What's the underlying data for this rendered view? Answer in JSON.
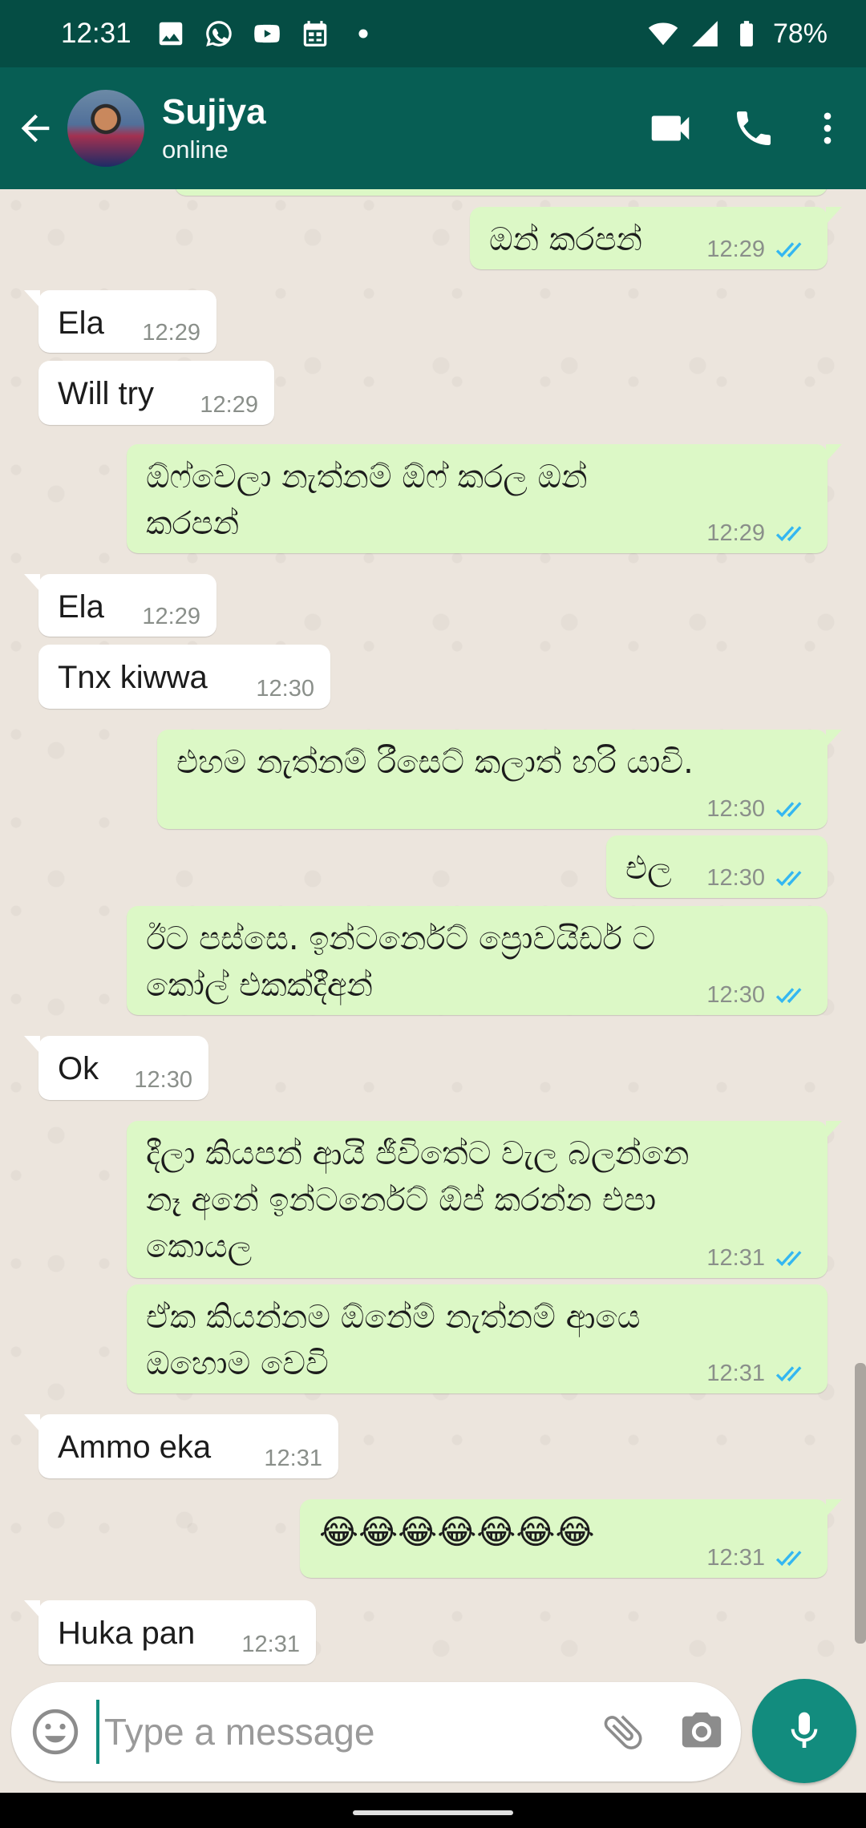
{
  "status_bar": {
    "time": "12:31",
    "battery": "78%",
    "left_icons": [
      "gallery-icon",
      "whatsapp-icon",
      "youtube-icon",
      "calendar-icon",
      "dot-icon"
    ],
    "right_icons": [
      "wifi-icon",
      "signal-icon",
      "battery-icon"
    ]
  },
  "header": {
    "contact_name": "Sujiya",
    "contact_status": "online"
  },
  "colors": {
    "status_bar": "#054d44",
    "header": "#075e54",
    "accent": "#128c7e",
    "outgoing_bubble": "#dcf8c6",
    "incoming_bubble": "#ffffff",
    "chat_background": "#ece5dd",
    "read_ticks": "#34b7f1"
  },
  "messages": [
    {
      "direction": "out",
      "text": "ඔන් කරපන්",
      "time": "12:29",
      "read": true
    },
    {
      "direction": "in",
      "text": "Ela",
      "time": "12:29"
    },
    {
      "direction": "in",
      "text": "Will try",
      "time": "12:29"
    },
    {
      "direction": "out",
      "text": "ඕෆ්වෙලා නැත්නම් ඕෆ් කරල ඔන්\nකරපන්",
      "time": "12:29",
      "read": true
    },
    {
      "direction": "in",
      "text": "Ela",
      "time": "12:29"
    },
    {
      "direction": "in",
      "text": "Tnx kiwwa",
      "time": "12:30"
    },
    {
      "direction": "out",
      "text": "එහම නැත්නම් රීසෙට් කලාත් හරි යාවි.",
      "time": "12:30",
      "read": true
    },
    {
      "direction": "out",
      "text": "එල",
      "time": "12:30",
      "read": true
    },
    {
      "direction": "out",
      "text": "ඊට පස්සෙ. ඉන්ටර්නෙට්  ප්‍රොවයිඩර් ට\nකෝල් එකක්දීඅන්",
      "time": "12:30",
      "read": true
    },
    {
      "direction": "in",
      "text": "Ok",
      "time": "12:30"
    },
    {
      "direction": "out",
      "text": "දීලා කියපන් ආයි ජීවිතේට වැල බලන්නෙ\nනෑ අනේ ඉන්ටර්නෙට්  ඕප් කරන්න එපා\nකොයල",
      "time": "12:31",
      "read": true
    },
    {
      "direction": "out",
      "text": "ඒක කියන්නම ඕනේම් නැත්නම් ආයෙ\nඔහොම වෙවි",
      "time": "12:31",
      "read": true
    },
    {
      "direction": "in",
      "text": "Ammo eka",
      "time": "12:31"
    },
    {
      "direction": "out",
      "text": "😂😂😂😂😂😂😂",
      "time": "12:31",
      "read": true
    },
    {
      "direction": "in",
      "text": "Huka pan",
      "time": "12:31"
    }
  ],
  "composer": {
    "placeholder": "Type a message",
    "value": ""
  }
}
